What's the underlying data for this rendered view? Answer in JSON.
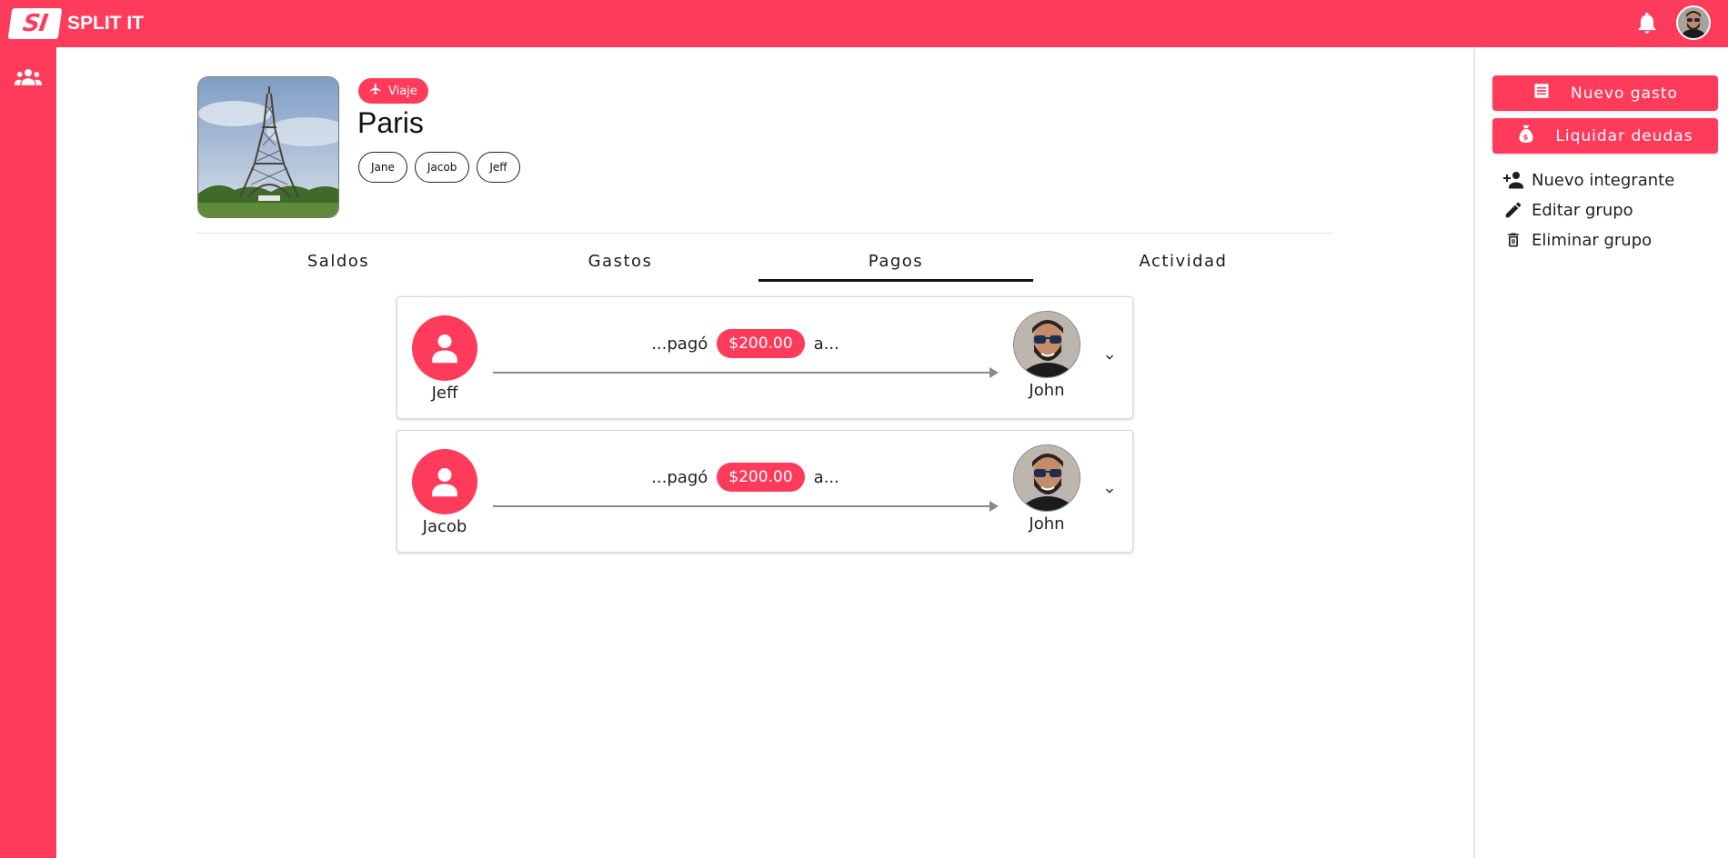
{
  "app": {
    "logo_mark": "SI",
    "logo_text": "SPLIT IT"
  },
  "topbar": {
    "notifications_icon": "bell-icon",
    "user_avatar": "user-avatar"
  },
  "sidebar": {
    "items": [
      {
        "icon": "groups-icon"
      }
    ]
  },
  "actions": {
    "new_expense": "Nuevo gasto",
    "settle_debts": "Liquidar deudas",
    "new_member": "Nuevo integrante",
    "edit_group": "Editar grupo",
    "delete_group": "Eliminar grupo"
  },
  "group": {
    "category": "Viaje",
    "name": "Paris",
    "members": [
      "Jane",
      "Jacob",
      "Jeff"
    ]
  },
  "tabs": [
    {
      "label": "Saldos"
    },
    {
      "label": "Gastos"
    },
    {
      "label": "Pagos"
    },
    {
      "label": "Actividad"
    }
  ],
  "active_tab": "Pagos",
  "payments": [
    {
      "payer": "Jeff",
      "verb": "...pagó",
      "amount": "$200.00",
      "connector": "a...",
      "payee": "John"
    },
    {
      "payer": "Jacob",
      "verb": "...pagó",
      "amount": "$200.00",
      "connector": "a...",
      "payee": "John"
    }
  ],
  "colors": {
    "brand": "#FF3B5C",
    "text": "#1a1a1a",
    "arrow": "#8a8a8a"
  }
}
